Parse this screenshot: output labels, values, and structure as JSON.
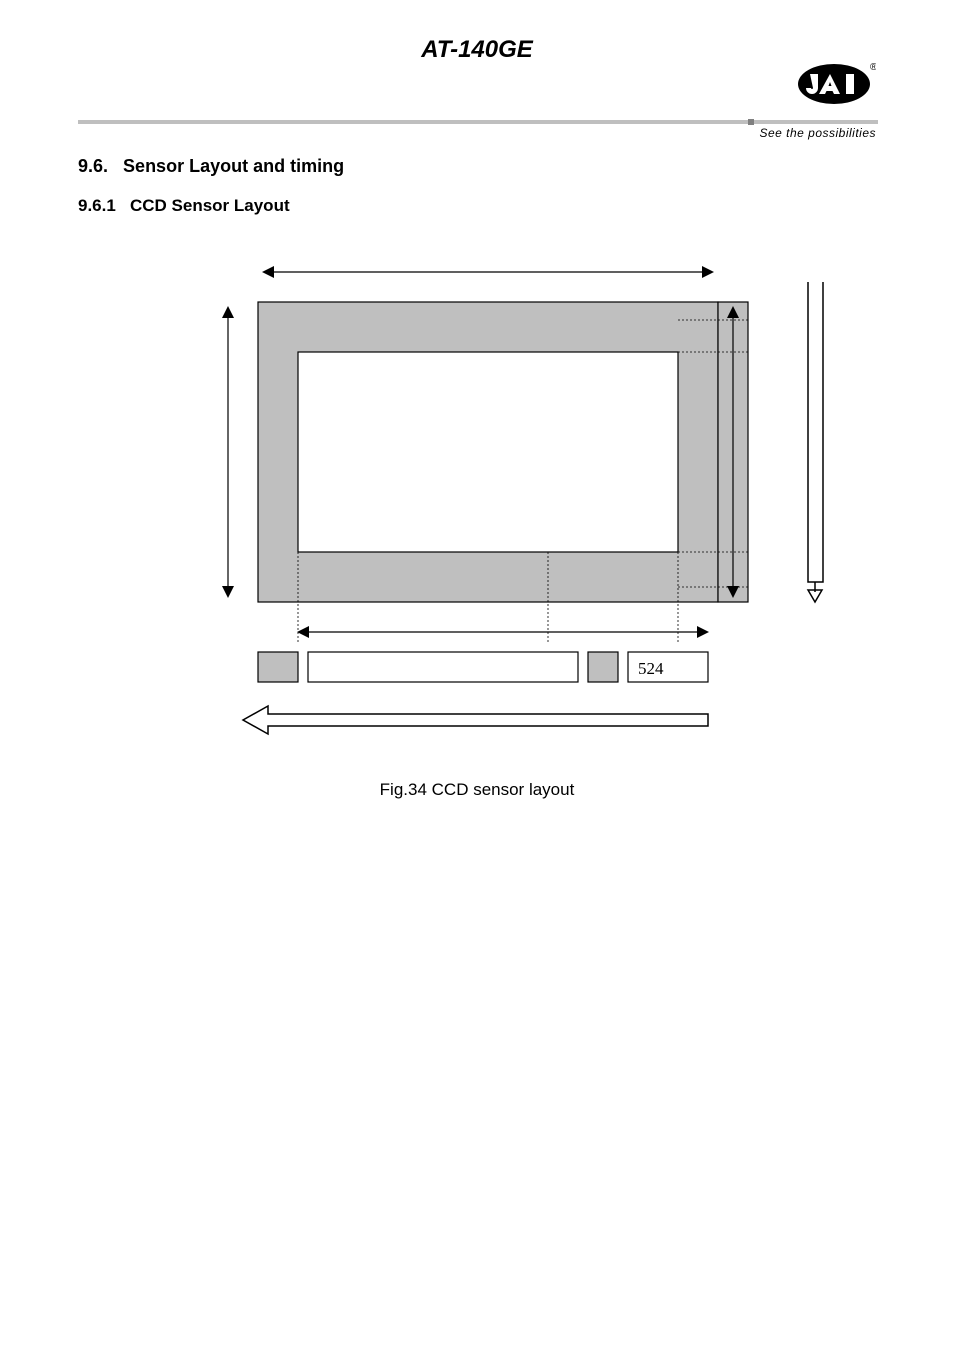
{
  "header": {
    "title": "AT-140GE",
    "tagline": "See the possibilities"
  },
  "section": {
    "number": "9.6.",
    "title": "Sensor Layout and timing",
    "sub_number": "9.6.1",
    "sub_title": "CCD Sensor Layout"
  },
  "figure": {
    "box_label": "524",
    "caption": "Fig.34   CCD sensor layout"
  }
}
